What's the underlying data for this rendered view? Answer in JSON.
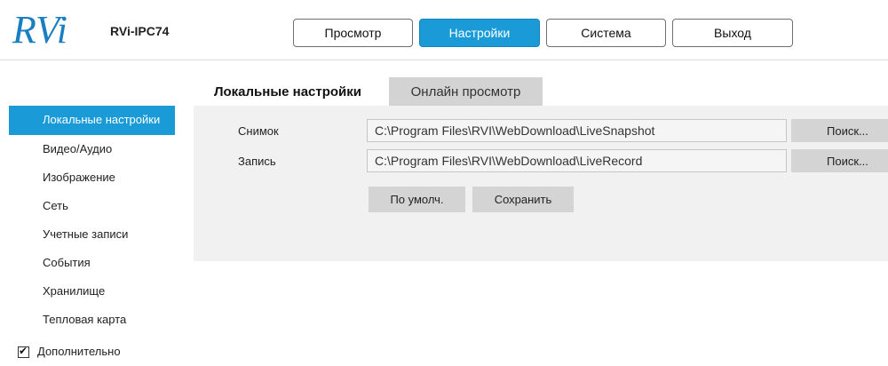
{
  "header": {
    "logo_text": "RVi",
    "model": "RVi-IPC74",
    "brand_color": "#1a7fc1"
  },
  "topnav": {
    "items": [
      {
        "label": "Просмотр",
        "active": false
      },
      {
        "label": "Настройки",
        "active": true
      },
      {
        "label": "Система",
        "active": false
      },
      {
        "label": "Выход",
        "active": false
      }
    ],
    "active_color": "#1a9bd7"
  },
  "sidebar": {
    "items": [
      {
        "label": "Локальные настройки",
        "active": true
      },
      {
        "label": "Видео/Аудио"
      },
      {
        "label": "Изображение"
      },
      {
        "label": "Сеть"
      },
      {
        "label": "Учетные записи"
      },
      {
        "label": "События"
      },
      {
        "label": "Хранилище"
      },
      {
        "label": "Тепловая карта"
      }
    ],
    "expand_item": {
      "label": "Дополнительно",
      "checked": true
    }
  },
  "tabs": [
    {
      "label": "Локальные настройки",
      "active": true
    },
    {
      "label": "Онлайн просмотр",
      "active": false
    }
  ],
  "form": {
    "snapshot": {
      "label": "Снимок",
      "value": "C:\\Program Files\\RVI\\WebDownload\\LiveSnapshot",
      "browse_label": "Поиск..."
    },
    "record": {
      "label": "Запись",
      "value": "C:\\Program Files\\RVI\\WebDownload\\LiveRecord",
      "browse_label": "Поиск..."
    },
    "default_label": "По умолч.",
    "save_label": "Сохранить"
  },
  "icons": {
    "checkbox_checked": "check-mark-icon"
  }
}
